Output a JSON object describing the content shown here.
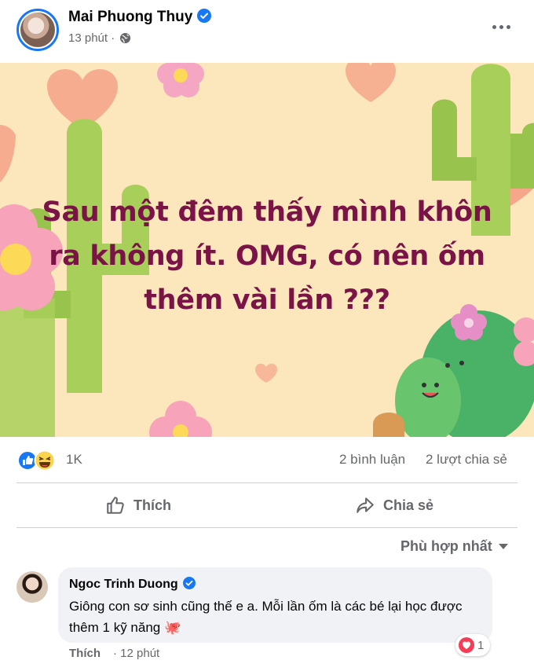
{
  "post": {
    "author": "Mai Phuong Thuy",
    "time": "13 phút",
    "separator": "·",
    "text": "Sau một đêm thấy mình khôn ra không ít. OMG, có nên ốm thêm vài lần ???"
  },
  "stats": {
    "reaction_count": "1K",
    "comments": "2 bình luận",
    "shares": "2 lượt chia sẻ"
  },
  "actions": {
    "like": "Thích",
    "share": "Chia sẻ"
  },
  "comments_section": {
    "sort_label": "Phù hợp nhất",
    "items": [
      {
        "author": "Ngoc Trinh Duong",
        "text": "Giông con sơ sinh cũng thế e a. Mỗi lần ốm là các bé lại học được thêm 1 kỹ năng",
        "emoji": "🐙",
        "like_label": "Thích",
        "time": "12 phút",
        "reaction_count": "1"
      }
    ]
  },
  "colors": {
    "accent": "#1877f2",
    "post_text": "#7b1446",
    "image_bg": "#fce7bd",
    "secondary_text": "#65676b"
  },
  "icons": [
    "verified-badge-icon",
    "globe-icon",
    "more-dots-icon",
    "like-reaction-icon",
    "haha-reaction-icon",
    "thumbs-up-icon",
    "share-arrow-icon",
    "caret-down-icon",
    "heart-reaction-icon",
    "octopus-emoji"
  ]
}
